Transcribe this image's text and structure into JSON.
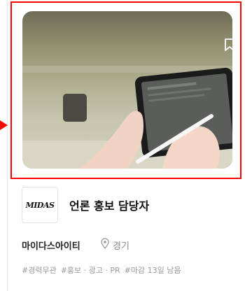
{
  "job": {
    "title": "언론 홍보 담당자",
    "company": "마이다스아이티",
    "location": "경기",
    "logo_text": "MIDAS",
    "tags": [
      "#경력무관",
      "#홍보 · 광고 · PR",
      "#마감 13일 남음"
    ]
  },
  "icons": {
    "bookmark": "bookmark-icon",
    "location": "location-pin-icon",
    "pointer": "red-arrow-indicator"
  },
  "colors": {
    "highlight": "#ff0000",
    "title": "#111111",
    "muted": "#8a8a8a"
  }
}
